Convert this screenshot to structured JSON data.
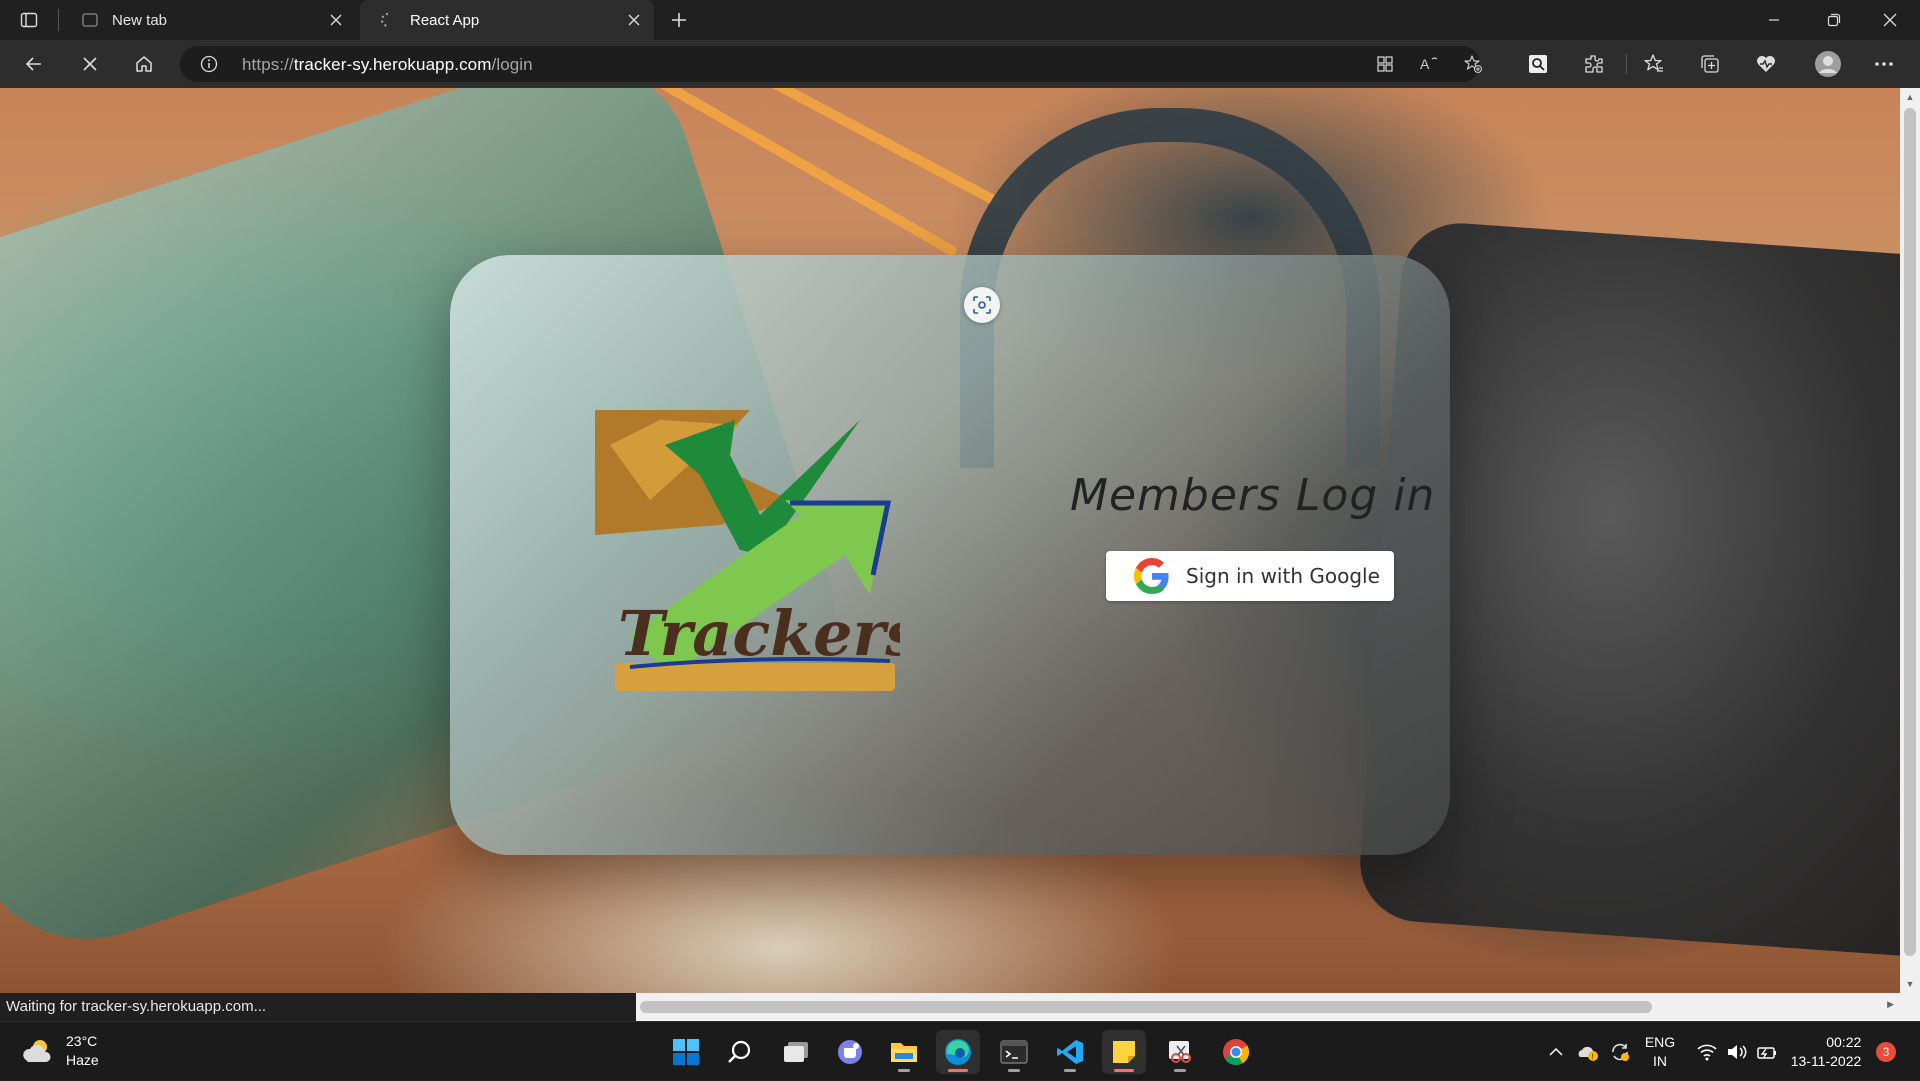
{
  "browser": {
    "tabs": [
      {
        "label": "New tab",
        "active": false
      },
      {
        "label": "React App",
        "active": true
      }
    ],
    "url": {
      "scheme": "https://",
      "host": "tracker-sy.herokuapp.com",
      "path": "/login"
    },
    "status_text": "Waiting for tracker-sy.herokuapp.com..."
  },
  "page": {
    "logo_text": "Trackersy",
    "heading": "Members Log in",
    "google_button_label": "Sign in with Google"
  },
  "taskbar": {
    "weather": {
      "temp": "23°C",
      "condition": "Haze"
    },
    "language": {
      "line1": "ENG",
      "line2": "IN"
    },
    "clock": {
      "time": "00:22",
      "date": "13-11-2022"
    },
    "notification_count": "3"
  },
  "colors": {
    "logo_green": "#1e8a3a",
    "logo_light_green": "#7ec850",
    "logo_gold": "#d6a03c",
    "logo_brown": "#b07a2a",
    "logo_blue": "#1c3d8f",
    "google_blue": "#4285F4",
    "google_red": "#EA4335",
    "google_yellow": "#FBBC05",
    "google_green": "#34A853"
  }
}
